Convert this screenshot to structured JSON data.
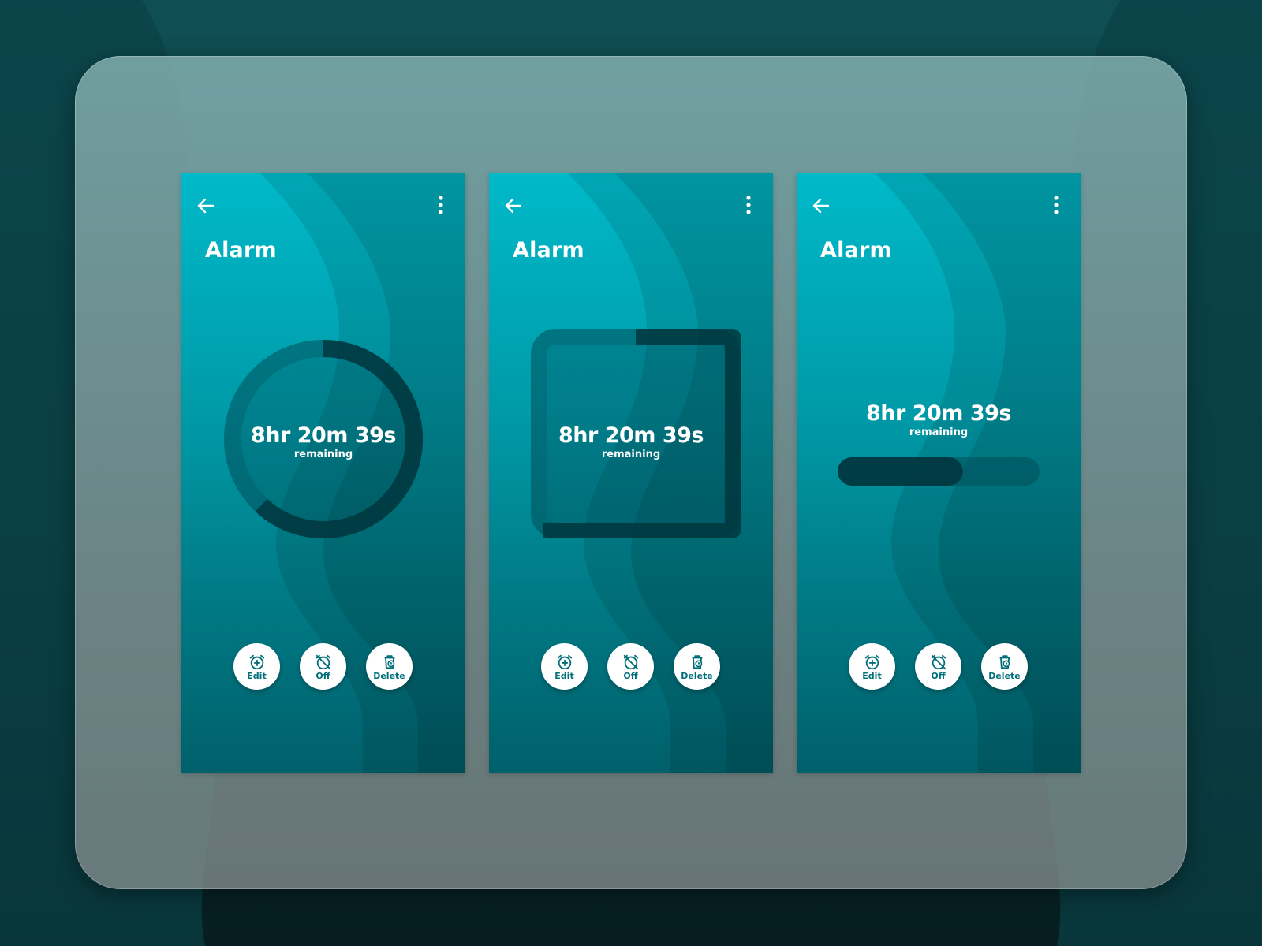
{
  "screens": [
    {
      "variant": "circular",
      "title": "Alarm",
      "time": "8hr 20m 39s",
      "sub": "remaining",
      "progress": 0.62,
      "actions": [
        {
          "label": "Edit",
          "icon": "alarm-add-icon"
        },
        {
          "label": "Off",
          "icon": "alarm-off-icon"
        },
        {
          "label": "Delete",
          "icon": "delete-alarm-icon"
        }
      ]
    },
    {
      "variant": "square",
      "title": "Alarm",
      "time": "8hr 20m 39s",
      "sub": "remaining",
      "progress": 0.62,
      "actions": [
        {
          "label": "Edit",
          "icon": "alarm-add-icon"
        },
        {
          "label": "Off",
          "icon": "alarm-off-icon"
        },
        {
          "label": "Delete",
          "icon": "delete-alarm-icon"
        }
      ]
    },
    {
      "variant": "linear",
      "title": "Alarm",
      "time": "8hr 20m 39s",
      "sub": "remaining",
      "progress": 0.62,
      "actions": [
        {
          "label": "Edit",
          "icon": "alarm-add-icon"
        },
        {
          "label": "Off",
          "icon": "alarm-off-icon"
        },
        {
          "label": "Delete",
          "icon": "delete-alarm-icon"
        }
      ]
    }
  ],
  "colors": {
    "accent": "#00b9c9",
    "accent_dark": "#00606b",
    "track": "#004f5a",
    "fill": "#00343c",
    "icon": "#006f7a"
  }
}
